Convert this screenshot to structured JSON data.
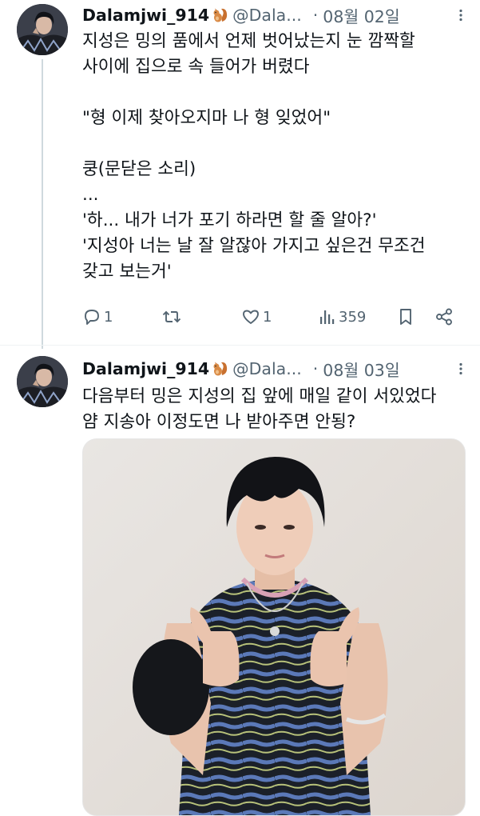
{
  "tweets": [
    {
      "display_name": "Dalamjwi_914",
      "handle": "@Dala...",
      "separator": "·",
      "date": "08월 02일",
      "avatar_icon": "profile-photo",
      "name_emoji": "squirrel",
      "text": "지성은 밍의 품에서 언제 벗어났는지 눈 깜짝할\n사이에 집으로 속 들어가 버렸다\n\n\"형 이제 찾아오지마 나 형 잊었어\"\n\n쿵(문닫은 소리)\n...\n'하... 내가 너가 포기 하라면 할 줄 알아?'\n'지성아 너는 날 잘 알잖아 가지고 싶은건 무조건\n갖고 보는거'",
      "actions": {
        "reply_count": "1",
        "retweet_count": "",
        "like_count": "1",
        "view_count": "359"
      }
    },
    {
      "display_name": "Dalamjwi_914",
      "handle": "@Dala...",
      "separator": "·",
      "date": "08월 03일",
      "avatar_icon": "profile-photo",
      "name_emoji": "squirrel",
      "text": "다음부터 밍은 지성의 집 앞에 매일 같이 서있었다\n얌 지송아 이정도면 나 받아주면 안됭?",
      "media": {
        "type": "photo",
        "description_icon": "person-photo"
      }
    }
  ],
  "colors": {
    "text_primary": "#0f1419",
    "text_secondary": "#536471",
    "thread_line": "#cfd9de"
  }
}
